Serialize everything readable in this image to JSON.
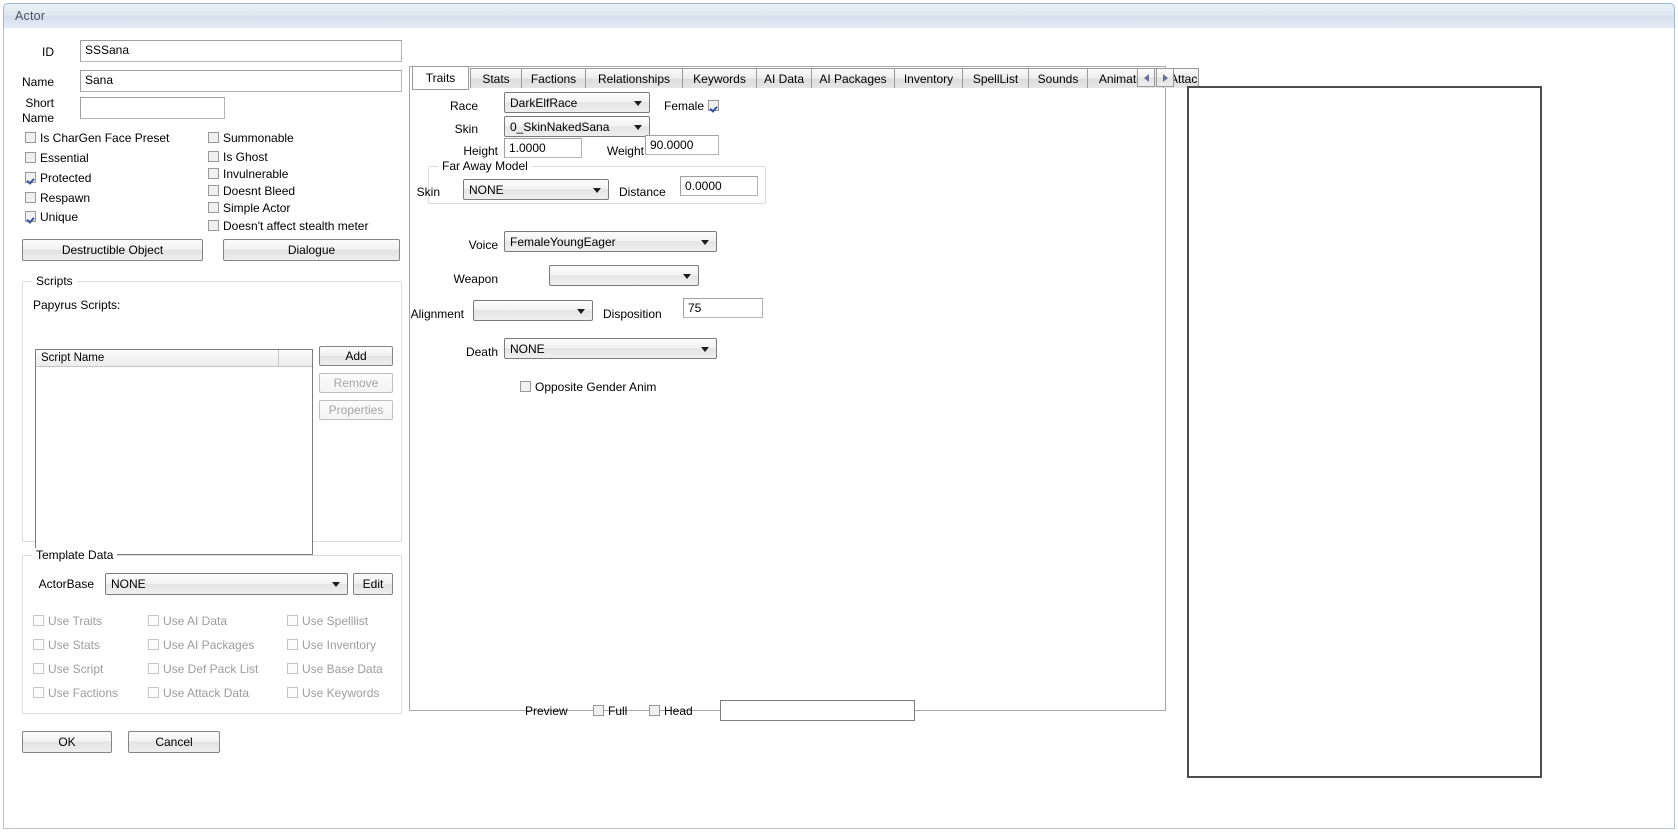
{
  "window": {
    "title": "Actor"
  },
  "left": {
    "fields": [
      {
        "label": "ID",
        "value": "SSSana"
      },
      {
        "label": "Name",
        "value": "Sana"
      }
    ],
    "short_name": {
      "label_line1": "Short",
      "label_line2": "Name",
      "value": ""
    },
    "flags_col1": [
      {
        "label": "Is CharGen Face Preset",
        "checked": false
      },
      {
        "label": "Essential",
        "checked": false
      },
      {
        "label": "Protected",
        "checked": true
      },
      {
        "label": "Respawn",
        "checked": false
      },
      {
        "label": "Unique",
        "checked": true
      }
    ],
    "flags_col2": [
      {
        "label": "Summonable",
        "checked": false
      },
      {
        "label": "Is Ghost",
        "checked": false
      },
      {
        "label": "Invulnerable",
        "checked": false
      },
      {
        "label": "Doesnt Bleed",
        "checked": false
      },
      {
        "label": "Simple Actor",
        "checked": false
      },
      {
        "label": "Doesn't affect stealth meter",
        "checked": false
      }
    ],
    "buttons": {
      "destructible_object": "Destructible Object",
      "dialogue": "Dialogue"
    },
    "scripts": {
      "group_title": "Scripts",
      "papyrus_label": "Papyrus Scripts:",
      "column_header": "Script Name",
      "rows": [],
      "add": "Add",
      "remove": "Remove",
      "properties": "Properties"
    },
    "template_data": {
      "group_title": "Template Data",
      "actorbase_label": "ActorBase",
      "actorbase_value": "NONE",
      "edit": "Edit",
      "checks": [
        {
          "label": "Use Traits",
          "checked": false,
          "disabled": true
        },
        {
          "label": "Use AI Data",
          "checked": false,
          "disabled": true
        },
        {
          "label": "Use Spelllist",
          "checked": false,
          "disabled": true
        },
        {
          "label": "Use Stats",
          "checked": false,
          "disabled": true
        },
        {
          "label": "Use AI Packages",
          "checked": false,
          "disabled": true
        },
        {
          "label": "Use Inventory",
          "checked": false,
          "disabled": true
        },
        {
          "label": "Use Script",
          "checked": false,
          "disabled": true
        },
        {
          "label": "Use Def Pack List",
          "checked": false,
          "disabled": true
        },
        {
          "label": "Use Base Data",
          "checked": false,
          "disabled": true
        },
        {
          "label": "Use Factions",
          "checked": false,
          "disabled": true
        },
        {
          "label": "Use Attack Data",
          "checked": false,
          "disabled": true
        },
        {
          "label": "Use Keywords",
          "checked": false,
          "disabled": true
        }
      ]
    },
    "ok": "OK",
    "cancel": "Cancel"
  },
  "tabs": {
    "items": [
      {
        "label": "Traits",
        "selected": true
      },
      {
        "label": "Stats",
        "selected": false
      },
      {
        "label": "Factions",
        "selected": false
      },
      {
        "label": "Relationships",
        "selected": false
      },
      {
        "label": "Keywords",
        "selected": false
      },
      {
        "label": "AI Data",
        "selected": false
      },
      {
        "label": "AI Packages",
        "selected": false
      },
      {
        "label": "Inventory",
        "selected": false
      },
      {
        "label": "SpellList",
        "selected": false
      },
      {
        "label": "Sounds",
        "selected": false
      },
      {
        "label": "Animation",
        "selected": false
      },
      {
        "label": "Attac",
        "selected": false
      }
    ],
    "scroll_prev": "◀",
    "scroll_next": "▶"
  },
  "traits": {
    "race_label": "Race",
    "race_value": "DarkElfRace",
    "female_label": "Female",
    "female_checked": true,
    "skin_label": "Skin",
    "skin_value": "0_SkinNakedSana",
    "height_label": "Height",
    "height_value": "1.0000",
    "weight_label": "Weight",
    "weight_value": "90.0000",
    "far_away": {
      "group_title": "Far Away Model",
      "skin_label": "Skin",
      "skin_value": "NONE",
      "distance_label": "Distance",
      "distance_value": "0.0000"
    },
    "voice_label": "Voice",
    "voice_value": "FemaleYoungEager",
    "weapon_label": "Weapon",
    "weapon_value": "",
    "alignment_label": "Alignment",
    "alignment_value": "",
    "disposition_label": "Disposition",
    "disposition_value": "75",
    "death_label": "Death",
    "death_value": "NONE",
    "opposite_gender_label": "Opposite Gender Anim",
    "opposite_gender_checked": false
  },
  "preview": {
    "label": "Preview",
    "full_label": "Full",
    "full_checked": false,
    "head_label": "Head",
    "head_checked": false,
    "field_value": ""
  }
}
